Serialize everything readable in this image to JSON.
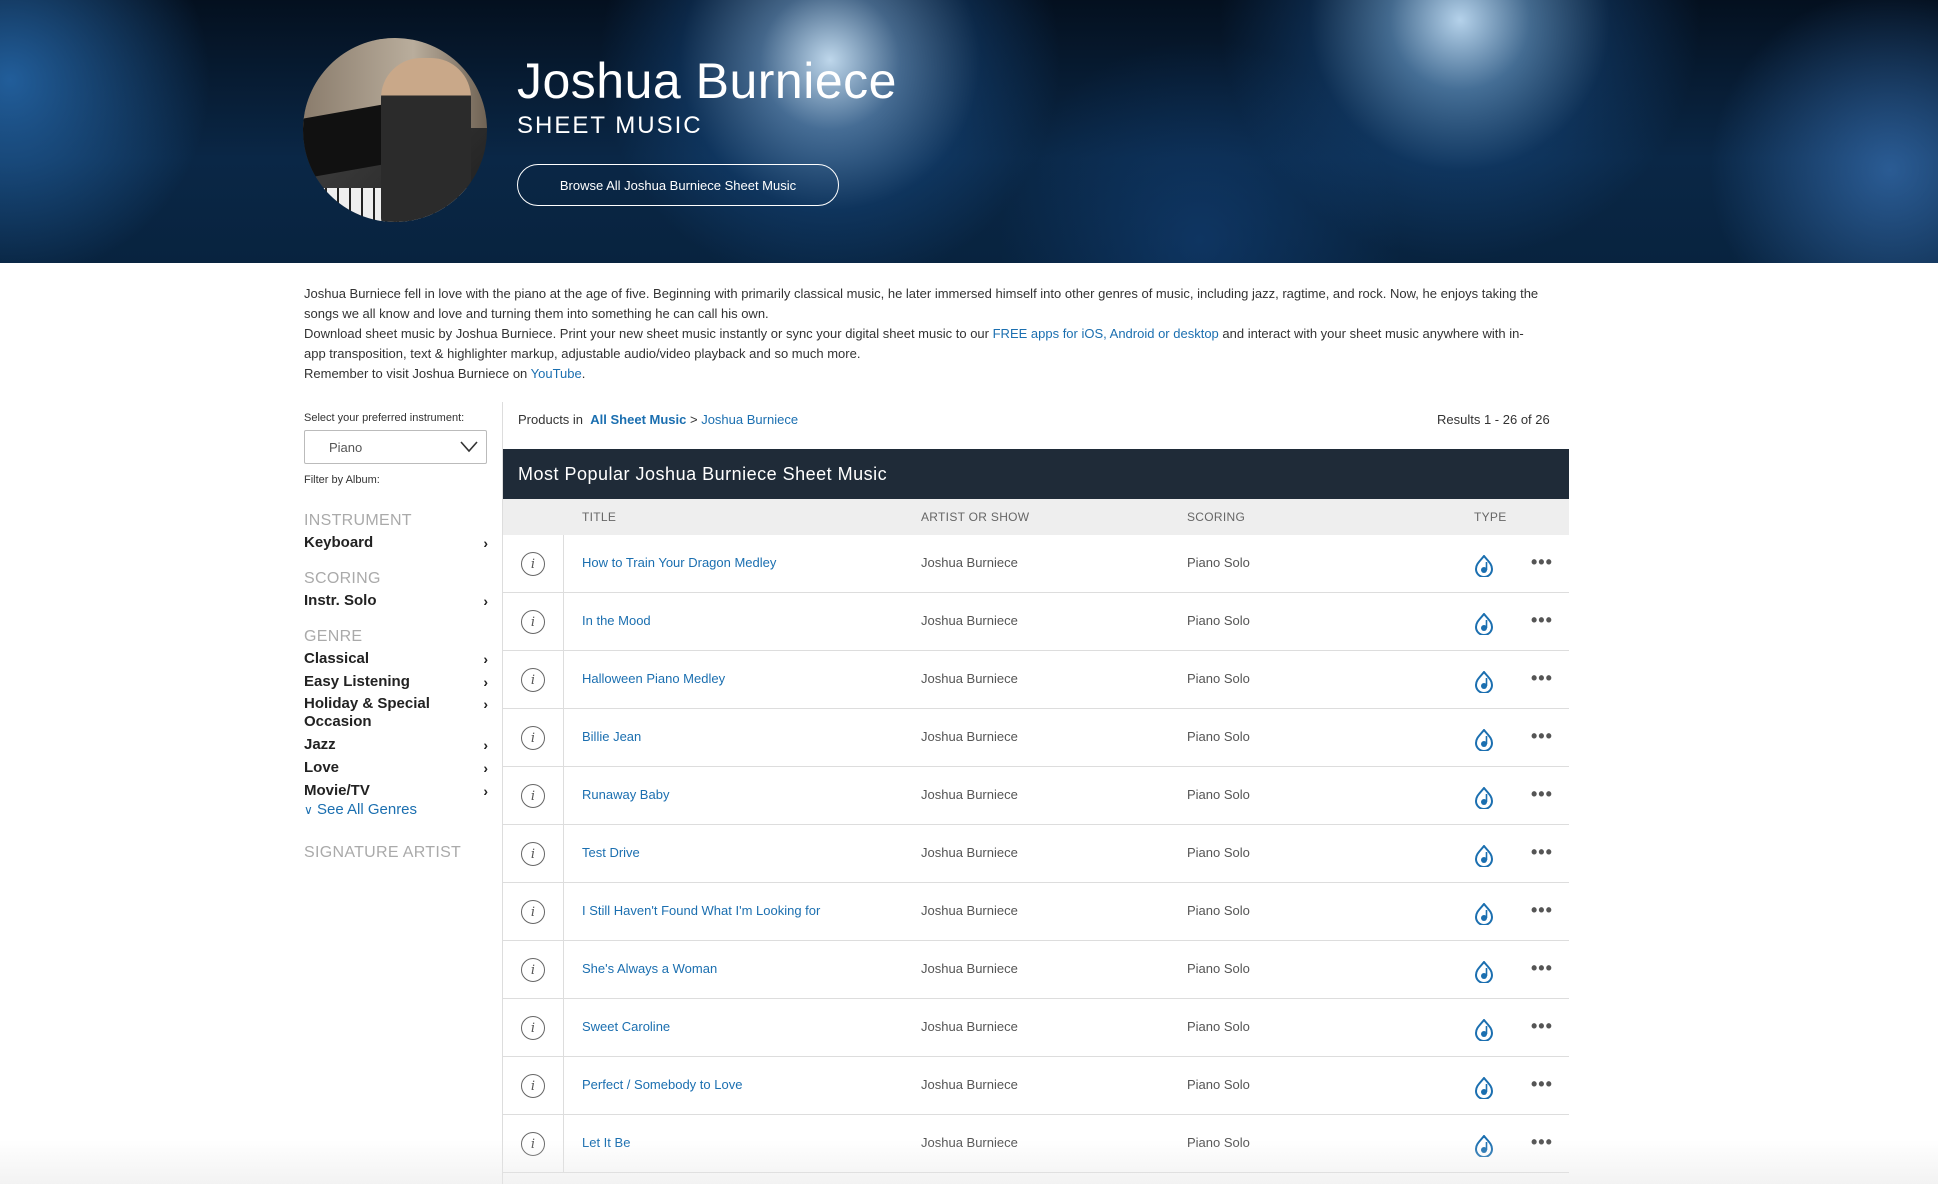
{
  "hero": {
    "artist_name": "Joshua Burniece",
    "subtitle": "SHEET MUSIC",
    "browse_button": "Browse All Joshua Burniece Sheet Music"
  },
  "description": {
    "p1": "Joshua Burniece fell in love with the piano at the age of five. Beginning with primarily classical music, he later immersed himself into other genres of music, including jazz, ragtime, and rock. Now, he enjoys taking the songs we all know and love and turning them into something he can call his own.",
    "p2_start": "Download sheet music by Joshua Burniece. Print your new sheet music instantly or sync your digital sheet music to our ",
    "p2_link": "FREE apps for iOS, Android or desktop",
    "p2_end": " and interact with your sheet music anywhere with in-app transposition, text & highlighter markup, adjustable audio/video playback and so much more.",
    "p3_start": "Remember to visit Joshua Burniece on ",
    "p3_link": "YouTube",
    "p3_end": "."
  },
  "sidebar": {
    "instrument_label": "Select your preferred instrument:",
    "instrument_value": "Piano",
    "filter_album": "Filter by Album:",
    "instrument_head": "INSTRUMENT",
    "instrument_item": "Keyboard",
    "scoring_head": "SCORING",
    "scoring_item": "Instr. Solo",
    "genre_head": "GENRE",
    "genres": [
      "Classical",
      "Easy Listening",
      "Holiday & Special Occasion",
      "Jazz",
      "Love",
      "Movie/TV"
    ],
    "see_all": "See All Genres",
    "signature_head": "SIGNATURE ARTIST"
  },
  "main": {
    "crumb_prefix": "Products in",
    "crumb_all": "All Sheet Music",
    "crumb_sep": ">",
    "crumb_artist": "Joshua Burniece",
    "results": "Results 1 - 26 of 26",
    "table_title": "Most Popular Joshua Burniece Sheet Music",
    "columns": {
      "title": "TITLE",
      "artist": "ARTIST OR SHOW",
      "scoring": "SCORING",
      "type": "TYPE"
    },
    "rows": [
      {
        "title": "How to Train Your Dragon Medley",
        "artist": "Joshua Burniece",
        "scoring": "Piano Solo"
      },
      {
        "title": "In the Mood",
        "artist": "Joshua Burniece",
        "scoring": "Piano Solo"
      },
      {
        "title": "Halloween Piano Medley",
        "artist": "Joshua Burniece",
        "scoring": "Piano Solo"
      },
      {
        "title": "Billie Jean",
        "artist": "Joshua Burniece",
        "scoring": "Piano Solo"
      },
      {
        "title": "Runaway Baby",
        "artist": "Joshua Burniece",
        "scoring": "Piano Solo"
      },
      {
        "title": "Test Drive",
        "artist": "Joshua Burniece",
        "scoring": "Piano Solo"
      },
      {
        "title": "I Still Haven't Found What I'm Looking for",
        "artist": "Joshua Burniece",
        "scoring": "Piano Solo"
      },
      {
        "title": "She's Always a Woman",
        "artist": "Joshua Burniece",
        "scoring": "Piano Solo"
      },
      {
        "title": "Sweet Caroline",
        "artist": "Joshua Burniece",
        "scoring": "Piano Solo"
      },
      {
        "title": "Perfect / Somebody to Love",
        "artist": "Joshua Burniece",
        "scoring": "Piano Solo"
      },
      {
        "title": "Let It Be",
        "artist": "Joshua Burniece",
        "scoring": "Piano Solo"
      }
    ]
  },
  "colors": {
    "link": "#1b6fb0",
    "table_header": "#1f2b38"
  },
  "icons": {
    "info": "info-circle-icon",
    "type": "digital-note-icon",
    "more": "more-dots-icon",
    "chevron": "chevron-right-icon"
  }
}
